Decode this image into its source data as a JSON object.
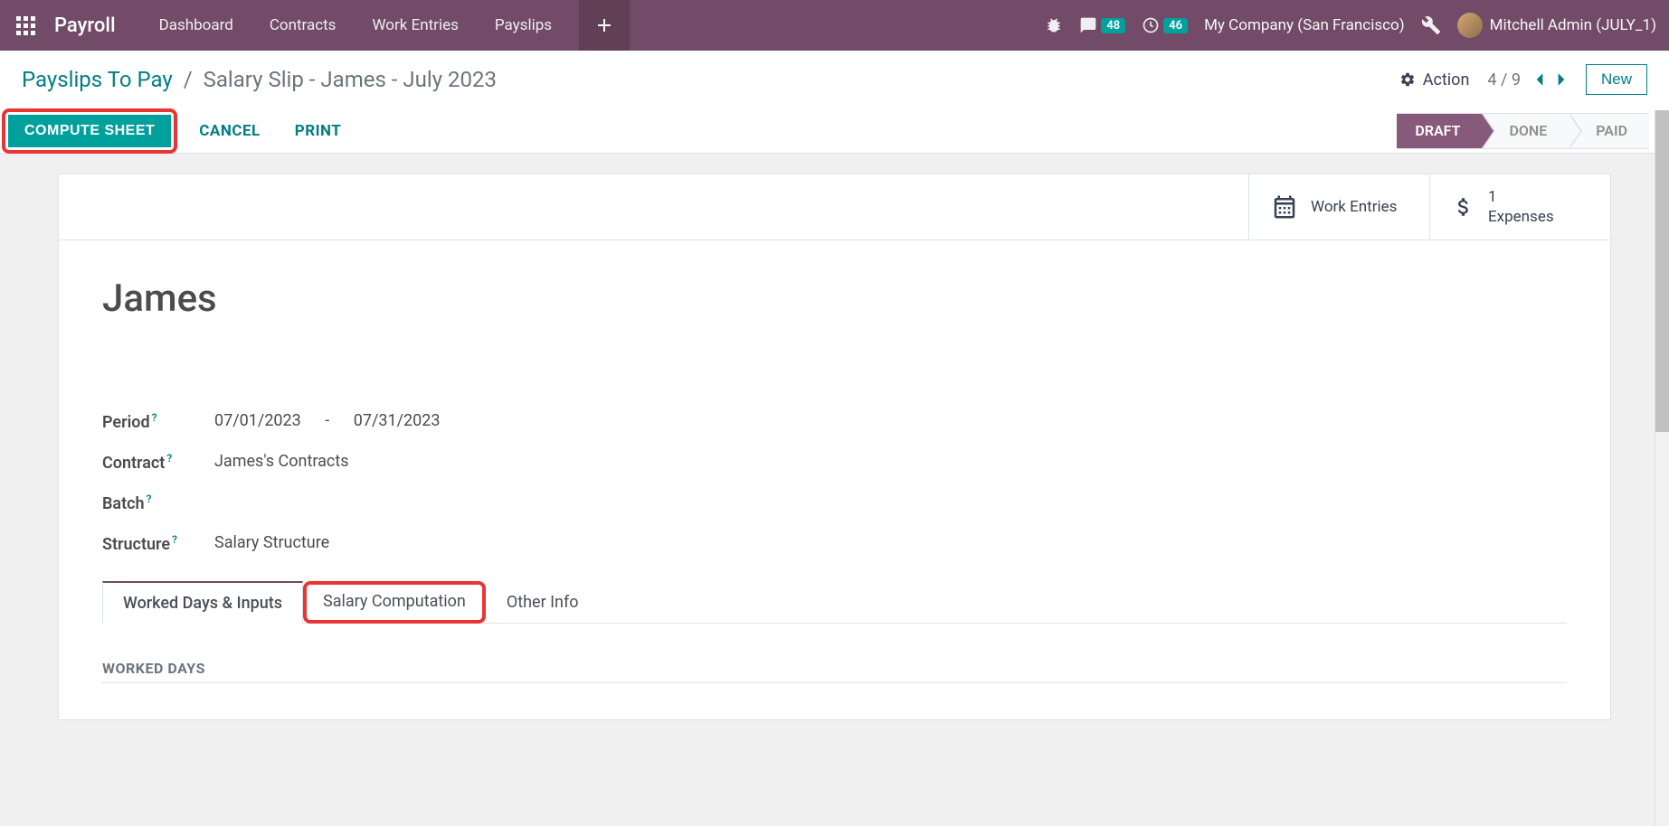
{
  "app_title": "Payroll",
  "nav": {
    "dashboard": "Dashboard",
    "contracts": "Contracts",
    "work_entries": "Work Entries",
    "payslips": "Payslips"
  },
  "topbar": {
    "messages_count": "48",
    "activities_count": "46",
    "company": "My Company (San Francisco)",
    "user": "Mitchell Admin (JULY_1)"
  },
  "breadcrumb": {
    "parent": "Payslips To Pay",
    "sep": "/",
    "current": "Salary Slip - James - July 2023"
  },
  "controls": {
    "action": "Action",
    "pager": "4 / 9",
    "new": "New"
  },
  "actions": {
    "compute": "COMPUTE SHEET",
    "cancel": "CANCEL",
    "print": "PRINT"
  },
  "status": {
    "draft": "DRAFT",
    "done": "DONE",
    "paid": "PAID"
  },
  "stats": {
    "work_entries": "Work Entries",
    "expenses_count": "1",
    "expenses_label": "Expenses"
  },
  "record": {
    "title": "James",
    "period_label": "Period",
    "period_from": "07/01/2023",
    "period_sep": "-",
    "period_to": "07/31/2023",
    "contract_label": "Contract",
    "contract_value": "James's Contracts",
    "batch_label": "Batch",
    "batch_value": "",
    "structure_label": "Structure",
    "structure_value": "Salary Structure"
  },
  "tabs": {
    "worked_days": "Worked Days & Inputs",
    "salary_comp": "Salary Computation",
    "other_info": "Other Info"
  },
  "section": {
    "worked_days_heading": "WORKED DAYS"
  },
  "help_marker": "?"
}
